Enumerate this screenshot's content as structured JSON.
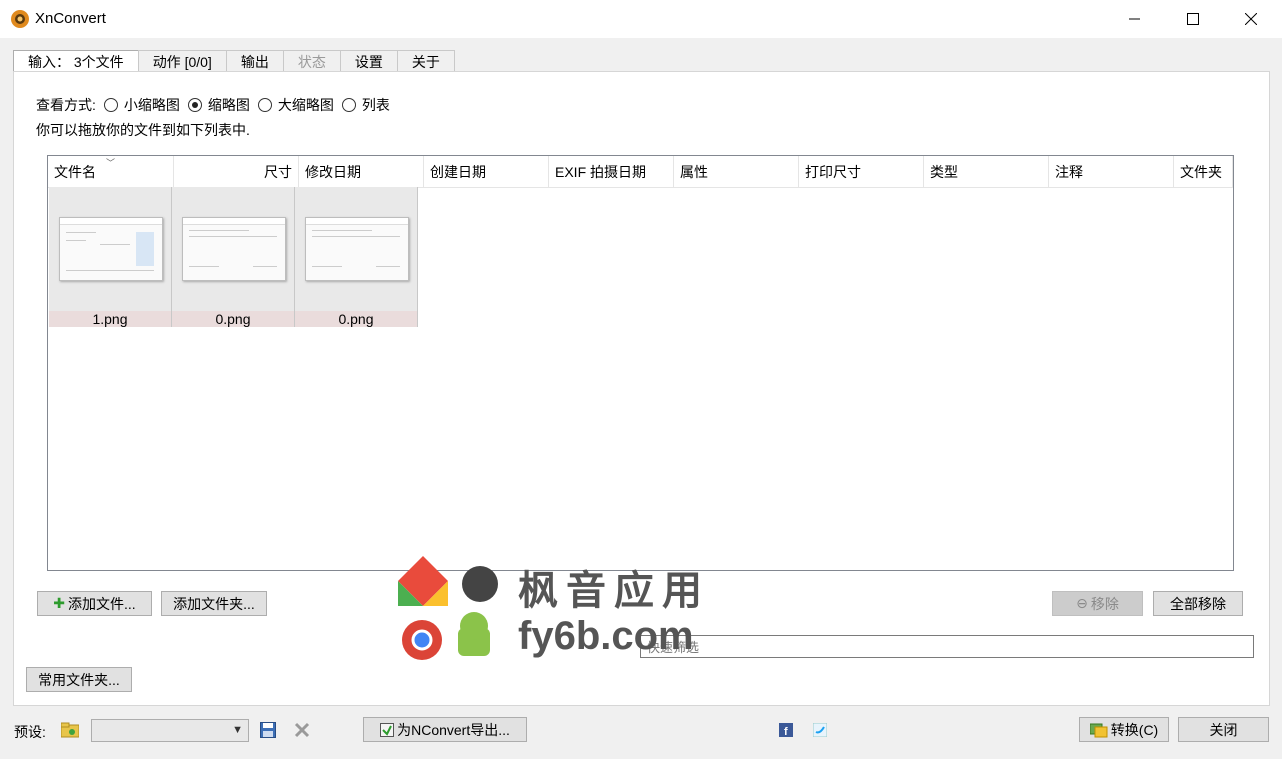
{
  "window": {
    "title": "XnConvert"
  },
  "tabs": [
    {
      "label": "输入： 3个文件",
      "state": "active"
    },
    {
      "label": "动作 [0/0]",
      "state": "normal"
    },
    {
      "label": "输出",
      "state": "normal"
    },
    {
      "label": "状态",
      "state": "disabled"
    },
    {
      "label": "设置",
      "state": "normal"
    },
    {
      "label": "关于",
      "state": "normal"
    }
  ],
  "view_mode": {
    "label": "查看方式:",
    "options": [
      {
        "label": "小缩略图",
        "checked": false
      },
      {
        "label": "缩略图",
        "checked": true
      },
      {
        "label": "大缩略图",
        "checked": false
      },
      {
        "label": "列表",
        "checked": false
      }
    ]
  },
  "hint": "你可以拖放你的文件到如下列表中.",
  "columns": [
    "文件名",
    "尺寸",
    "修改日期",
    "创建日期",
    "EXIF 拍摄日期",
    "属性",
    "打印尺寸",
    "类型",
    "注释",
    "文件夹"
  ],
  "files": [
    {
      "name": "1.png"
    },
    {
      "name": "0.png"
    },
    {
      "name": "0.png"
    }
  ],
  "buttons": {
    "add_files": "添加文件...",
    "add_folder": "添加文件夹...",
    "remove": "移除",
    "remove_all": "全部移除",
    "common_folders": "常用文件夹...",
    "export_nconvert": "为NConvert导出...",
    "convert": "转换(C)",
    "close": "关闭"
  },
  "filter": {
    "value": "快速筛选"
  },
  "preset": {
    "label": "预设:",
    "value": ""
  },
  "watermark": {
    "line1": "枫音应用",
    "line2": "fy6b.com"
  },
  "colors": {
    "accent": "#1a73e8",
    "facebook": "#3b5998",
    "twitter": "#1da1f2"
  }
}
